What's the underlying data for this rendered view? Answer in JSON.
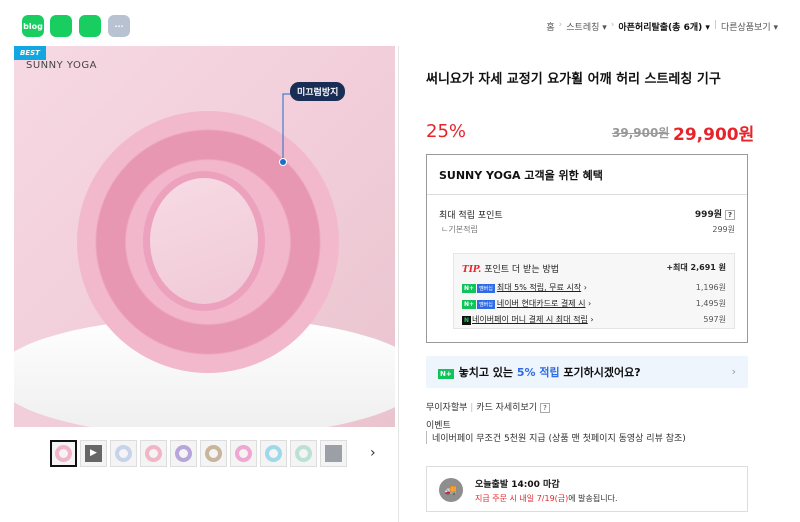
{
  "share_icons": [
    {
      "label": "blog",
      "color": "#19ce60"
    },
    {
      "label": "",
      "color": "#19ce60"
    },
    {
      "label": "",
      "color": "#19ce60"
    },
    {
      "label": "···",
      "color": "#b9c2d3"
    }
  ],
  "breadcrumb": {
    "home": "홈",
    "category": "스트레칭 ▾",
    "current": "아픈허리탈출(총 6개) ▾",
    "other": "다른상품보기 ▾"
  },
  "photo": {
    "best": "BEST",
    "brand": "SUNNY YOGA",
    "tag": "미끄럼방지"
  },
  "thumbnails": [
    "#f1b5c7",
    "#666666",
    "#c7d3ea",
    "#f1b5c7",
    "#b7a5dc",
    "#c8b59c",
    "#f0a7d2",
    "#9ed9ea",
    "#b9e2d2",
    "#9aa0a6"
  ],
  "product": {
    "title": "써니요가 자세 교정기 요가휠 어깨 허리 스트레칭 기구",
    "discount": "25%",
    "original_price": "39,900원",
    "price": "29,900원"
  },
  "benefit": {
    "header": "SUNNY YOGA 고객을 위한 혜택",
    "max_points_label": "최대 적립 포인트",
    "max_points_value": "999원",
    "help": "?",
    "basic_label": "ㄴ기본적립",
    "basic_value": "299원",
    "tip_label": "TIP.",
    "tip_text": "포인트 더 받는 방법",
    "tip_max": "+최대 2,691 원",
    "tip_rows": [
      {
        "text": "최대 5% 적립, 무료 시작",
        "value": "1,196원"
      },
      {
        "text": "네이버 현대카드로 결제 시",
        "value": "1,495원"
      },
      {
        "text": "네이버페이 머니 결제 시 최대 적립",
        "value": "597원"
      }
    ]
  },
  "banner": {
    "pre": "놓치고 있는 ",
    "hl": "5% 적립",
    "post": " 포기하시겠어요?"
  },
  "installment": {
    "label": "무이자할부",
    "card": "카드 자세히보기"
  },
  "event": {
    "label": "이벤트",
    "text": "네이버페이 무조건 5천원 지급 (상품 맨 첫페이지 동영상 리뷰 참조)"
  },
  "shipping": {
    "title": "오늘출발 14:00 마감",
    "notice_pre": "지급 주문 시 내일 7/19(금)",
    "notice_post": "에 발송됩니다."
  }
}
